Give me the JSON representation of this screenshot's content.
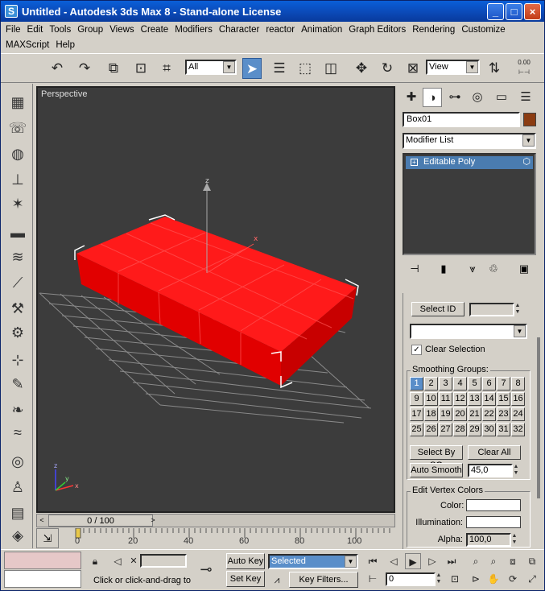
{
  "window": {
    "title": "Untitled - Autodesk 3ds Max 8  - Stand-alone License",
    "app_icon": "S",
    "minimize": "_",
    "maximize": "□",
    "close": "×"
  },
  "menu": [
    "File",
    "Edit",
    "Tools",
    "Group",
    "Views",
    "Create",
    "Modifiers",
    "Character",
    "reactor",
    "Animation",
    "Graph Editors",
    "Rendering",
    "Customize",
    "MAXScript",
    "Help"
  ],
  "toolbar": {
    "selection_filter": "All",
    "reference_coord": "View",
    "snap_readout": "0.00",
    "tools": [
      "undo-icon",
      "redo-icon",
      "link-icon",
      "unlink-icon",
      "bind-spacewarp-icon",
      "select-object-icon",
      "select-by-name-icon",
      "rect-selection-icon",
      "window-crossing-icon",
      "move-icon",
      "rotate-icon",
      "scale-icon",
      "pivot-center-icon"
    ]
  },
  "left_toolbar": [
    "box-icon",
    "sphere-icon",
    "light-icon",
    "camera-icon",
    "helper-icon",
    "spacewarp-icon",
    "systems-icon",
    "shapes-icon",
    "modifiers-icon",
    "cylinder-icon",
    "gear-icon",
    "tools-icon",
    "bone-icon",
    "biped-icon",
    "cloth-icon",
    "wave-icon",
    "globe-icon",
    "figure-icon",
    "book-icon",
    "color-icon"
  ],
  "viewport": {
    "label": "Perspective",
    "background": "#3c3c3c",
    "object_color": "#ff0000",
    "axis_labels": {
      "z": "z",
      "x": "x",
      "y": "y"
    }
  },
  "time_slider": {
    "position": "0 / 100",
    "prev": "<",
    "next": ">"
  },
  "trackbar": {
    "ticks": [
      "0",
      "20",
      "40",
      "60",
      "80",
      "100"
    ]
  },
  "command_panel": {
    "object_name": "Box01",
    "object_color": "#8b3c12",
    "modifier_list": "Modifier List",
    "stack_item": "Editable Poly",
    "select_id_label": "Select ID",
    "clear_selection": "Clear Selection",
    "clear_selection_checked": true,
    "smoothing_groups_title": "Smoothing Groups:",
    "smoothing_groups": [
      "1",
      "2",
      "3",
      "4",
      "5",
      "6",
      "7",
      "8",
      "9",
      "10",
      "11",
      "12",
      "13",
      "14",
      "15",
      "16",
      "17",
      "18",
      "19",
      "20",
      "21",
      "22",
      "23",
      "24",
      "25",
      "26",
      "27",
      "28",
      "29",
      "30",
      "31",
      "32"
    ],
    "active_group": "1",
    "select_by_sg": "Select By SG",
    "clear_all": "Clear All",
    "auto_smooth": "Auto Smooth",
    "auto_smooth_value": "45,0",
    "edit_vertex_colors_title": "Edit Vertex Colors",
    "color_label": "Color:",
    "illumination_label": "Illumination:",
    "alpha_label": "Alpha:",
    "alpha_value": "100,0"
  },
  "bottom": {
    "status_text": "Click or click-and-drag to",
    "auto_key": "Auto Key",
    "set_key": "Set Key",
    "key_mode": "Selected",
    "key_filters": "Key Filters...",
    "frame": "0",
    "swatch_top": "#e6c8c8",
    "swatch_bottom": "#ffffff"
  }
}
